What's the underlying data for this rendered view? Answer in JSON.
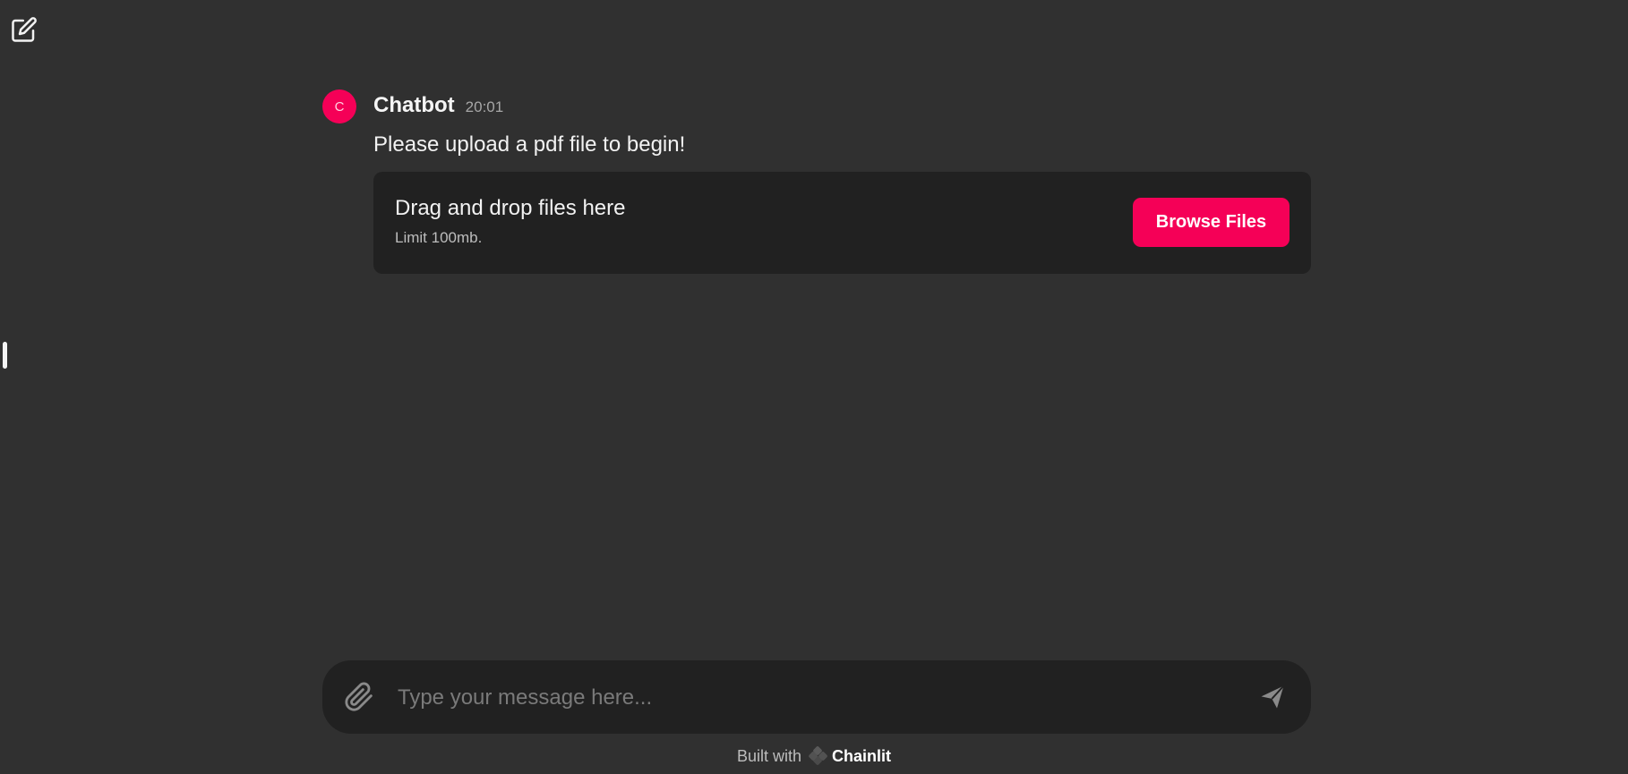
{
  "header": {
    "new_chat_icon": "edit-square-icon"
  },
  "message": {
    "avatar_letter": "C",
    "author": "Chatbot",
    "time": "20:01",
    "text": "Please upload a pdf file to begin!",
    "accent_color": "#f50057"
  },
  "upload": {
    "title": "Drag and drop files here",
    "limit": "Limit 100mb.",
    "button_label": "Browse Files"
  },
  "composer": {
    "placeholder": "Type your message here...",
    "value": "",
    "attach_icon": "paperclip-icon",
    "send_icon": "send-icon"
  },
  "footer": {
    "built_with": "Built with",
    "brand": "Chainlit"
  }
}
